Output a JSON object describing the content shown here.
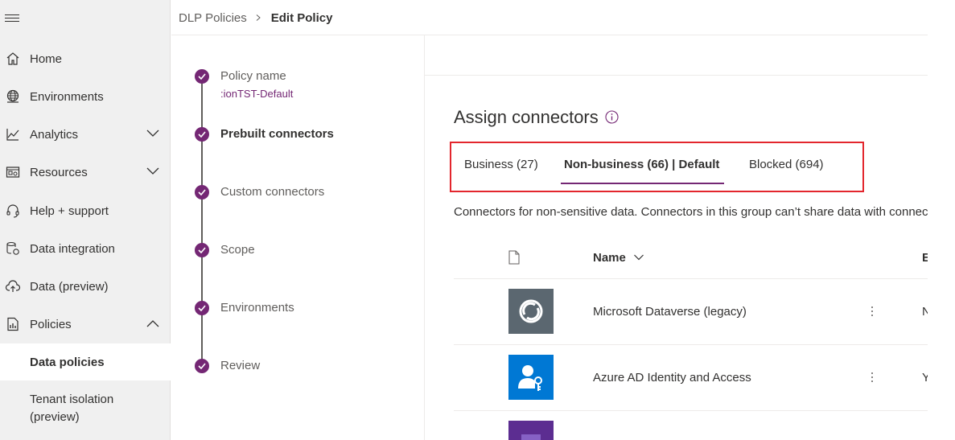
{
  "nav": {
    "items": [
      {
        "label": "Home",
        "icon": "home-icon"
      },
      {
        "label": "Environments",
        "icon": "globe-icon"
      },
      {
        "label": "Analytics",
        "icon": "chart-line-icon"
      },
      {
        "label": "Resources",
        "icon": "resources-icon"
      },
      {
        "label": "Help + support",
        "icon": "headset-icon"
      },
      {
        "label": "Data integration",
        "icon": "data-integration-icon"
      },
      {
        "label": "Data (preview)",
        "icon": "cloud-upload-icon"
      },
      {
        "label": "Policies",
        "icon": "policies-icon"
      }
    ],
    "sub_items": [
      {
        "label": "Data policies"
      },
      {
        "label_line1": "Tenant isolation",
        "label_line2": "(preview)"
      }
    ]
  },
  "breadcrumb": {
    "parent": "DLP Policies",
    "current": "Edit Policy"
  },
  "steps": [
    {
      "label": "Policy name",
      "sub": ":ionTST-Default"
    },
    {
      "label": "Prebuilt connectors"
    },
    {
      "label": "Custom connectors"
    },
    {
      "label": "Scope"
    },
    {
      "label": "Environments"
    },
    {
      "label": "Review"
    }
  ],
  "main": {
    "title": "Assign connectors",
    "tabs": [
      {
        "label": "Business (27)"
      },
      {
        "label": "Non-business (66) | Default"
      },
      {
        "label": "Blocked (694)"
      }
    ],
    "description": "Connectors for non-sensitive data. Connectors in this group can’t share data with connectors in other groups.",
    "columns": {
      "name": "Name",
      "next": "E"
    },
    "rows": [
      {
        "name": "Microsoft Dataverse (legacy)",
        "next_cut": "N",
        "logo_color": "#5b6770"
      },
      {
        "name": "Azure AD Identity and Access",
        "next_cut": "Y",
        "logo_color": "#0078d4"
      },
      {
        "name": "",
        "next_cut": "",
        "logo_color": "#5c2d91"
      }
    ]
  },
  "colors": {
    "accent": "#742774",
    "highlight_border": "#e3262d"
  }
}
